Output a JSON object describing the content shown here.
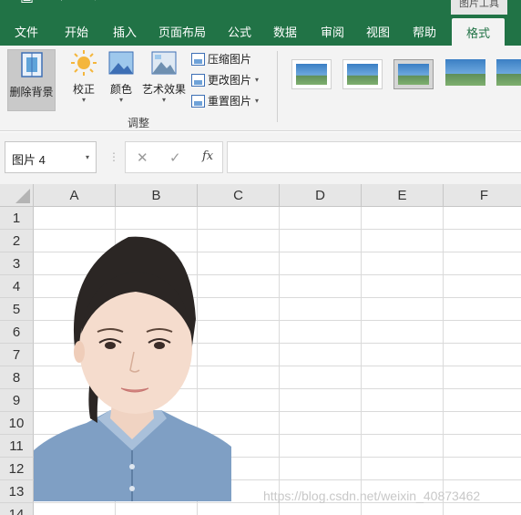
{
  "title_bar": {
    "context_tab": "图片工具"
  },
  "tabs": [
    {
      "label": "文件"
    },
    {
      "label": "开始"
    },
    {
      "label": "插入"
    },
    {
      "label": "页面布局"
    },
    {
      "label": "公式"
    },
    {
      "label": "数据"
    },
    {
      "label": "审阅"
    },
    {
      "label": "视图"
    },
    {
      "label": "帮助"
    },
    {
      "label": "格式",
      "active": true
    }
  ],
  "ribbon": {
    "remove_bg": "删除背景",
    "corrections": "校正",
    "color": "颜色",
    "artistic": "艺术效果",
    "compress": "压缩图片",
    "change": "更改图片",
    "reset": "重置图片",
    "group_label": "调整",
    "picture_styles": [
      "style-1",
      "style-2",
      "style-3",
      "style-4",
      "style-5"
    ]
  },
  "formula_bar": {
    "name_box": "图片 4",
    "cancel": "✕",
    "enter": "✓",
    "fx": "fx",
    "content": ""
  },
  "grid": {
    "columns": [
      "A",
      "B",
      "C",
      "D",
      "E",
      "F"
    ],
    "rows": [
      "1",
      "2",
      "3",
      "4",
      "5",
      "6",
      "7",
      "8",
      "9",
      "10",
      "11",
      "12",
      "13",
      "14"
    ]
  },
  "watermark": "https://blog.csdn.net/weixin_40873462",
  "colors": {
    "accent": "#217346",
    "ribbon_bg": "#f3f3f3",
    "header_bg": "#e6e6e6"
  }
}
